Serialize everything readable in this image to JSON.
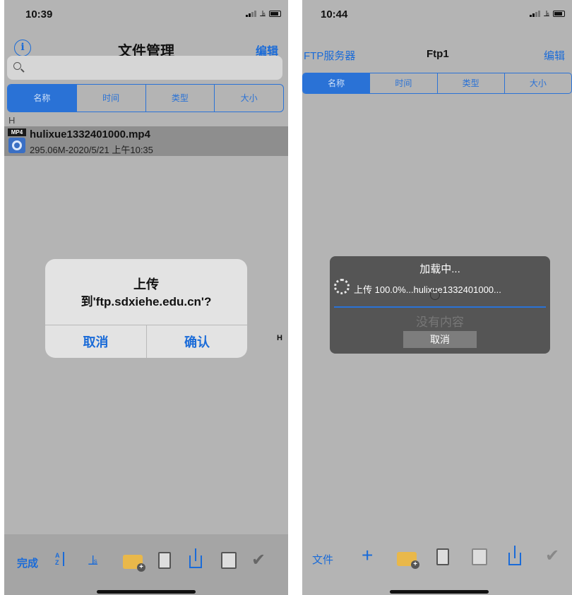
{
  "left": {
    "status_time": "10:39",
    "nav": {
      "info_icon": "info-icon",
      "title": "文件管理",
      "edit": "编辑"
    },
    "search": {
      "placeholder": ""
    },
    "tabs": [
      "名称",
      "时间",
      "类型",
      "大小"
    ],
    "section_header": "H",
    "file": {
      "badge": "MP4",
      "name": "hulixue1332401000.mp4",
      "meta": "295.06M-2020/5/21 上午10:35"
    },
    "alert": {
      "title": "上传",
      "message": "到'ftp.sdxiehe.edu.cn'?",
      "cancel": "取消",
      "confirm": "确认"
    },
    "index_letter": "H",
    "toolbar": {
      "done": "完成"
    }
  },
  "right": {
    "status_time": "10:44",
    "nav": {
      "back": "FTP服务器",
      "title": "Ftp1",
      "edit": "编辑"
    },
    "tabs": [
      "名称",
      "时间",
      "类型",
      "大小"
    ],
    "hud": {
      "title": "加载中...",
      "progress_text": "上传 100.0%...hulixue1332401000...",
      "empty_text": "没有内容",
      "cancel": "取消"
    },
    "toolbar": {
      "file": "文件"
    }
  },
  "colors": {
    "accent": "#1a6bd8",
    "background": "#b4b4b4",
    "hud": "#555555"
  }
}
